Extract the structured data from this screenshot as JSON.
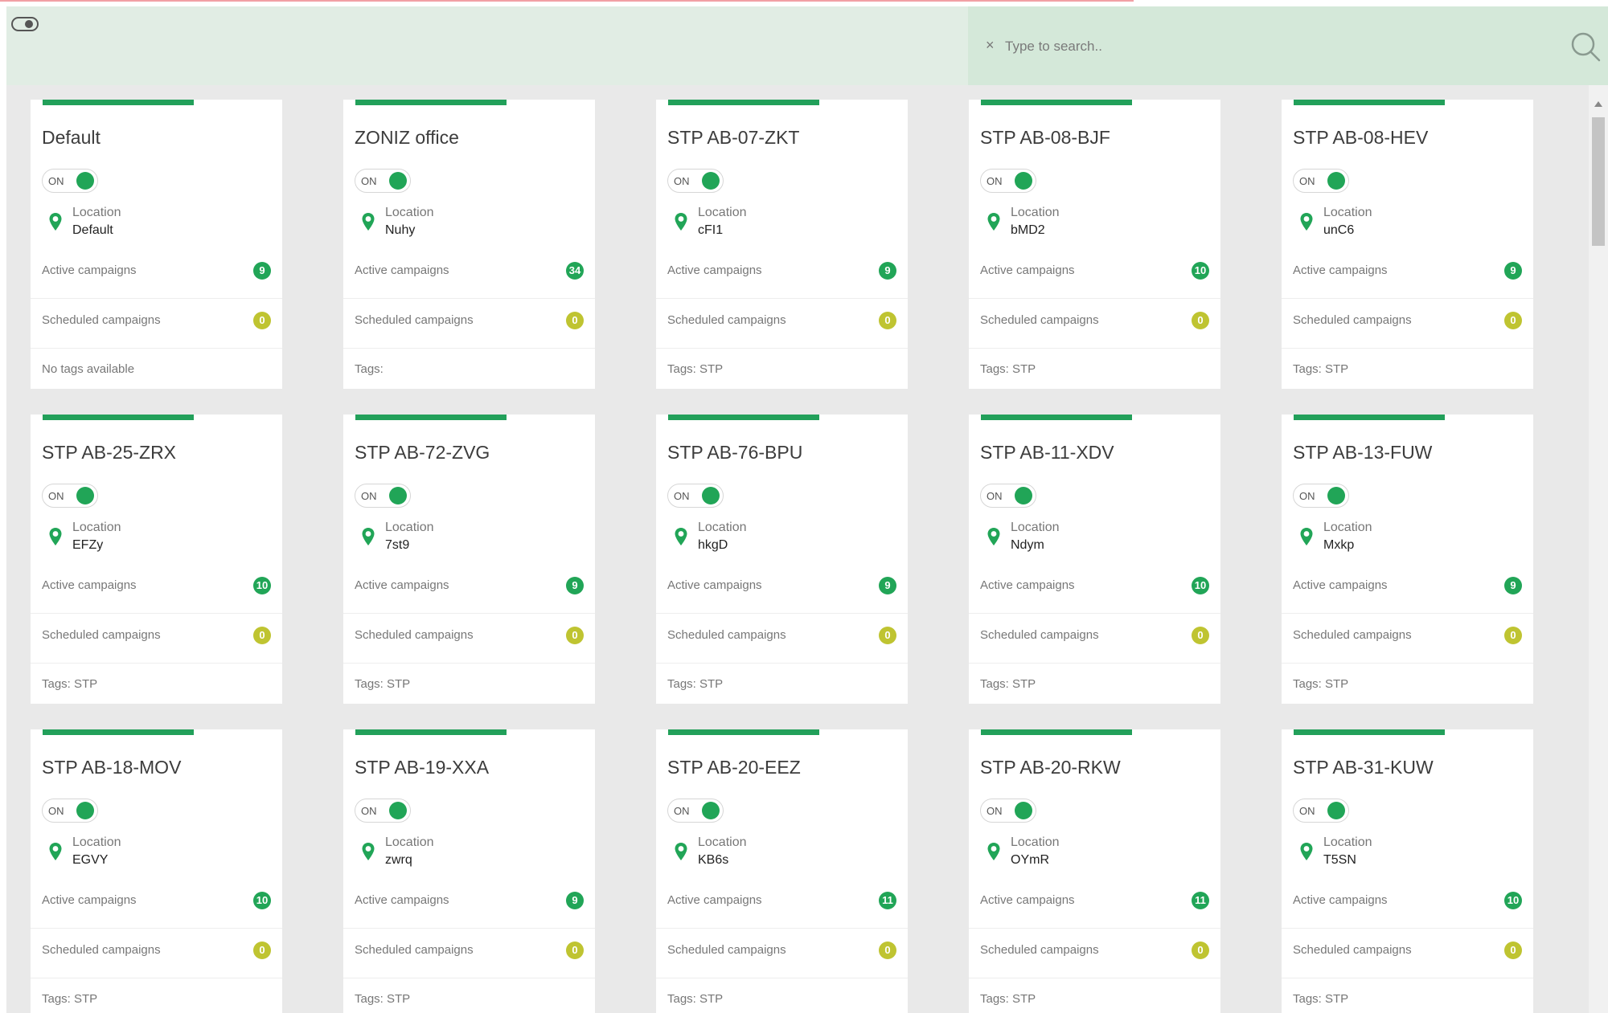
{
  "header": {
    "search_placeholder": "Type to search..",
    "clear_symbol": "×"
  },
  "colors": {
    "accent": "#22a05a",
    "active_badge": "#21a557",
    "scheduled_badge": "#bfc431",
    "header_bg": "#e1ede4",
    "content_bg": "#e9e9e9"
  },
  "labels": {
    "location": "Location",
    "active_campaigns": "Active campaigns",
    "scheduled_campaigns": "Scheduled campaigns",
    "switch_on": "ON"
  },
  "cards": [
    {
      "title": "Default",
      "location": "Default",
      "active": "9",
      "scheduled": "0",
      "tags": "No tags available"
    },
    {
      "title": "ZONIZ office",
      "location": "Nuhy",
      "active": "34",
      "scheduled": "0",
      "tags": "Tags:"
    },
    {
      "title": "STP AB-07-ZKT",
      "location": "cFI1",
      "active": "9",
      "scheduled": "0",
      "tags": "Tags: STP"
    },
    {
      "title": "STP AB-08-BJF",
      "location": "bMD2",
      "active": "10",
      "scheduled": "0",
      "tags": "Tags: STP"
    },
    {
      "title": "STP AB-08-HEV",
      "location": "unC6",
      "active": "9",
      "scheduled": "0",
      "tags": "Tags: STP"
    },
    {
      "title": "STP AB-25-ZRX",
      "location": "EFZy",
      "active": "10",
      "scheduled": "0",
      "tags": "Tags: STP"
    },
    {
      "title": "STP AB-72-ZVG",
      "location": "7st9",
      "active": "9",
      "scheduled": "0",
      "tags": "Tags: STP"
    },
    {
      "title": "STP AB-76-BPU",
      "location": "hkgD",
      "active": "9",
      "scheduled": "0",
      "tags": "Tags: STP"
    },
    {
      "title": "STP AB-11-XDV",
      "location": "Ndym",
      "active": "10",
      "scheduled": "0",
      "tags": "Tags: STP"
    },
    {
      "title": "STP AB-13-FUW",
      "location": "Mxkp",
      "active": "9",
      "scheduled": "0",
      "tags": "Tags: STP"
    },
    {
      "title": "STP AB-18-MOV",
      "location": "EGVY",
      "active": "10",
      "scheduled": "0",
      "tags": "Tags: STP"
    },
    {
      "title": "STP AB-19-XXA",
      "location": "zwrq",
      "active": "9",
      "scheduled": "0",
      "tags": "Tags: STP"
    },
    {
      "title": "STP AB-20-EEZ",
      "location": "KB6s",
      "active": "11",
      "scheduled": "0",
      "tags": "Tags: STP"
    },
    {
      "title": "STP AB-20-RKW",
      "location": "OYmR",
      "active": "11",
      "scheduled": "0",
      "tags": "Tags: STP"
    },
    {
      "title": "STP AB-31-KUW",
      "location": "T5SN",
      "active": "10",
      "scheduled": "0",
      "tags": "Tags: STP"
    }
  ]
}
